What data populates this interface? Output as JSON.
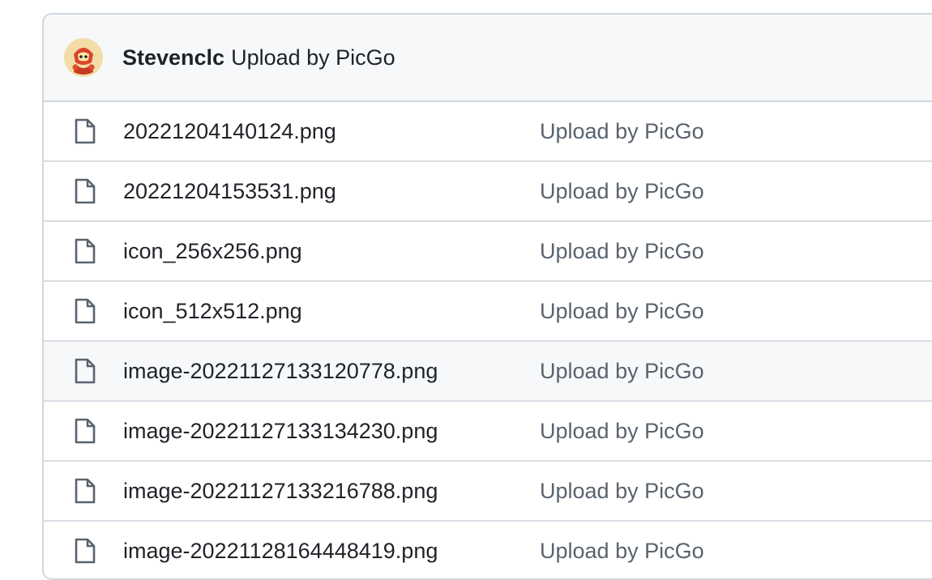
{
  "commit": {
    "author": "Stevenclc",
    "message": "Upload by PicGo"
  },
  "files": [
    {
      "name": "20221204140124.png",
      "commit_message": "Upload by PicGo",
      "icon": "file-icon"
    },
    {
      "name": "20221204153531.png",
      "commit_message": "Upload by PicGo",
      "icon": "file-icon"
    },
    {
      "name": "icon_256x256.png",
      "commit_message": "Upload by PicGo",
      "icon": "file-icon"
    },
    {
      "name": "icon_512x512.png",
      "commit_message": "Upload by PicGo",
      "icon": "file-icon"
    },
    {
      "name": "image-20221127133120778.png",
      "commit_message": "Upload by PicGo",
      "icon": "file-icon",
      "hovered": true
    },
    {
      "name": "image-20221127133134230.png",
      "commit_message": "Upload by PicGo",
      "icon": "file-icon"
    },
    {
      "name": "image-20221127133216788.png",
      "commit_message": "Upload by PicGo",
      "icon": "file-icon"
    },
    {
      "name": "image-20221128164448419.png",
      "commit_message": "Upload by PicGo",
      "icon": "file-icon"
    }
  ],
  "colors": {
    "header_bg": "#f6f8fa",
    "border": "#d0d7de",
    "muted_text": "#59636e",
    "hover_bg": "#f6f8fa"
  }
}
